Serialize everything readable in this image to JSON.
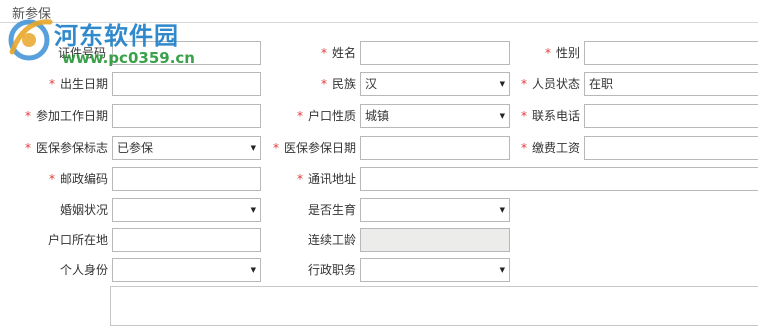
{
  "section_title": "新参保",
  "watermark": {
    "name": "河东软件园",
    "url": "www.pc0359.cn"
  },
  "fields": {
    "id_number": {
      "label": "证件号码",
      "value": ""
    },
    "name": {
      "label": "姓名",
      "value": ""
    },
    "gender": {
      "label": "性别",
      "value": ""
    },
    "birth_date": {
      "label": "出生日期",
      "value": ""
    },
    "ethnicity": {
      "label": "民族",
      "value": "汉"
    },
    "staff_status": {
      "label": "人员状态",
      "value": "在职"
    },
    "work_start_date": {
      "label": "参加工作日期",
      "value": ""
    },
    "household_type": {
      "label": "户口性质",
      "value": "城镇"
    },
    "phone": {
      "label": "联系电话",
      "value": ""
    },
    "medical_flag": {
      "label": "医保参保标志",
      "value": "已参保"
    },
    "medical_date": {
      "label": "医保参保日期",
      "value": ""
    },
    "contribution_wage": {
      "label": "缴费工资",
      "value": ""
    },
    "postal_code": {
      "label": "邮政编码",
      "value": ""
    },
    "address": {
      "label": "通讯地址",
      "value": ""
    },
    "marital_status": {
      "label": "婚姻状况",
      "value": ""
    },
    "has_children": {
      "label": "是否生育",
      "value": ""
    },
    "household_location": {
      "label": "户口所在地",
      "value": ""
    },
    "continuous_years": {
      "label": "连续工龄",
      "value": ""
    },
    "personal_identity": {
      "label": "个人身份",
      "value": ""
    },
    "admin_position": {
      "label": "行政职务",
      "value": ""
    }
  },
  "required_mark": "*",
  "dropdown_arrow": "▼",
  "colors": {
    "required": "#e23b3b",
    "watermark_name": "#1f80c8",
    "watermark_url": "#2a9a3a",
    "disabled_field": "#ececea"
  }
}
